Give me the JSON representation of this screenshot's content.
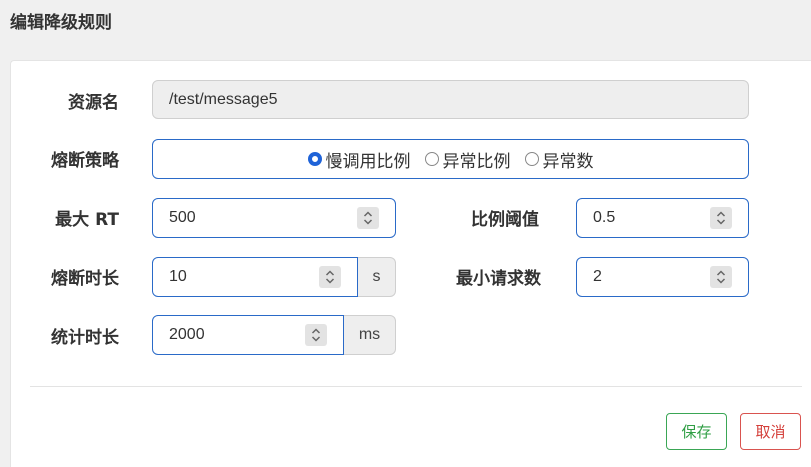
{
  "dialog": {
    "title": "编辑降级规则"
  },
  "form": {
    "resource": {
      "label": "资源名",
      "value": "/test/message5"
    },
    "strategy": {
      "label": "熔断策略",
      "options": [
        {
          "label": "慢调用比例",
          "checked": true
        },
        {
          "label": "异常比例",
          "checked": false
        },
        {
          "label": "异常数",
          "checked": false
        }
      ]
    },
    "max_rt": {
      "label": "最大 RT",
      "value": "500"
    },
    "ratio_threshold": {
      "label": "比例阈值",
      "value": "0.5"
    },
    "break_duration": {
      "label": "熔断时长",
      "value": "10",
      "unit": "s"
    },
    "min_requests": {
      "label": "最小请求数",
      "value": "2"
    },
    "stat_duration": {
      "label": "统计时长",
      "value": "2000",
      "unit": "ms"
    }
  },
  "buttons": {
    "save_label": "保存",
    "cancel_label": "取消"
  },
  "colors": {
    "accent": "#2a6ac8",
    "save": "#2f9e44",
    "cancel": "#d43f3a"
  }
}
